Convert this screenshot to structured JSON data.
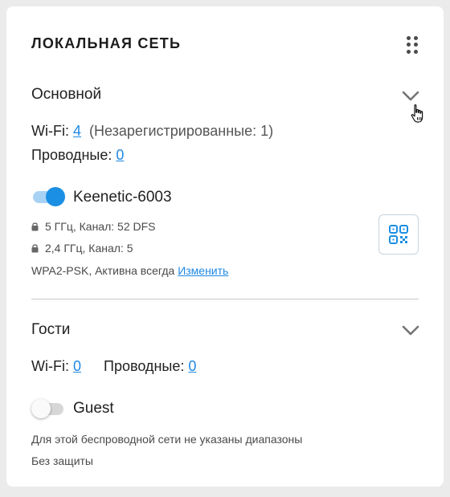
{
  "card": {
    "title": "ЛОКАЛЬНАЯ СЕТЬ",
    "menu_icon": "drag-dots-icon"
  },
  "main_section": {
    "title": "Основной",
    "expand_icon": "chevron-down-icon",
    "wifi_label": "Wi-Fi:",
    "wifi_count": "4",
    "unregistered_text": "(Незарегистрированные: 1)",
    "wired_label": "Проводные:",
    "wired_count": "0",
    "network": {
      "enabled": true,
      "name": "Keenetic-6003",
      "band_5": "5 ГГц, Канал: 52 DFS",
      "band_24": "2,4 ГГц, Канал: 5",
      "security": "WPA2-PSK, Активна всегда",
      "change_link": "Изменить",
      "qr_icon": "qr-code-icon"
    }
  },
  "guest_section": {
    "title": "Гости",
    "expand_icon": "chevron-down-icon",
    "wifi_label": "Wi-Fi:",
    "wifi_count": "0",
    "wired_label": "Проводные:",
    "wired_count": "0",
    "network": {
      "enabled": false,
      "name": "Guest",
      "note": "Для этой беспроводной сети не указаны диапазоны",
      "security": "Без защиты"
    }
  },
  "colors": {
    "accent": "#1b8fe3",
    "link": "#1e88e5",
    "background": "#ebebeb",
    "card": "#ffffff"
  }
}
